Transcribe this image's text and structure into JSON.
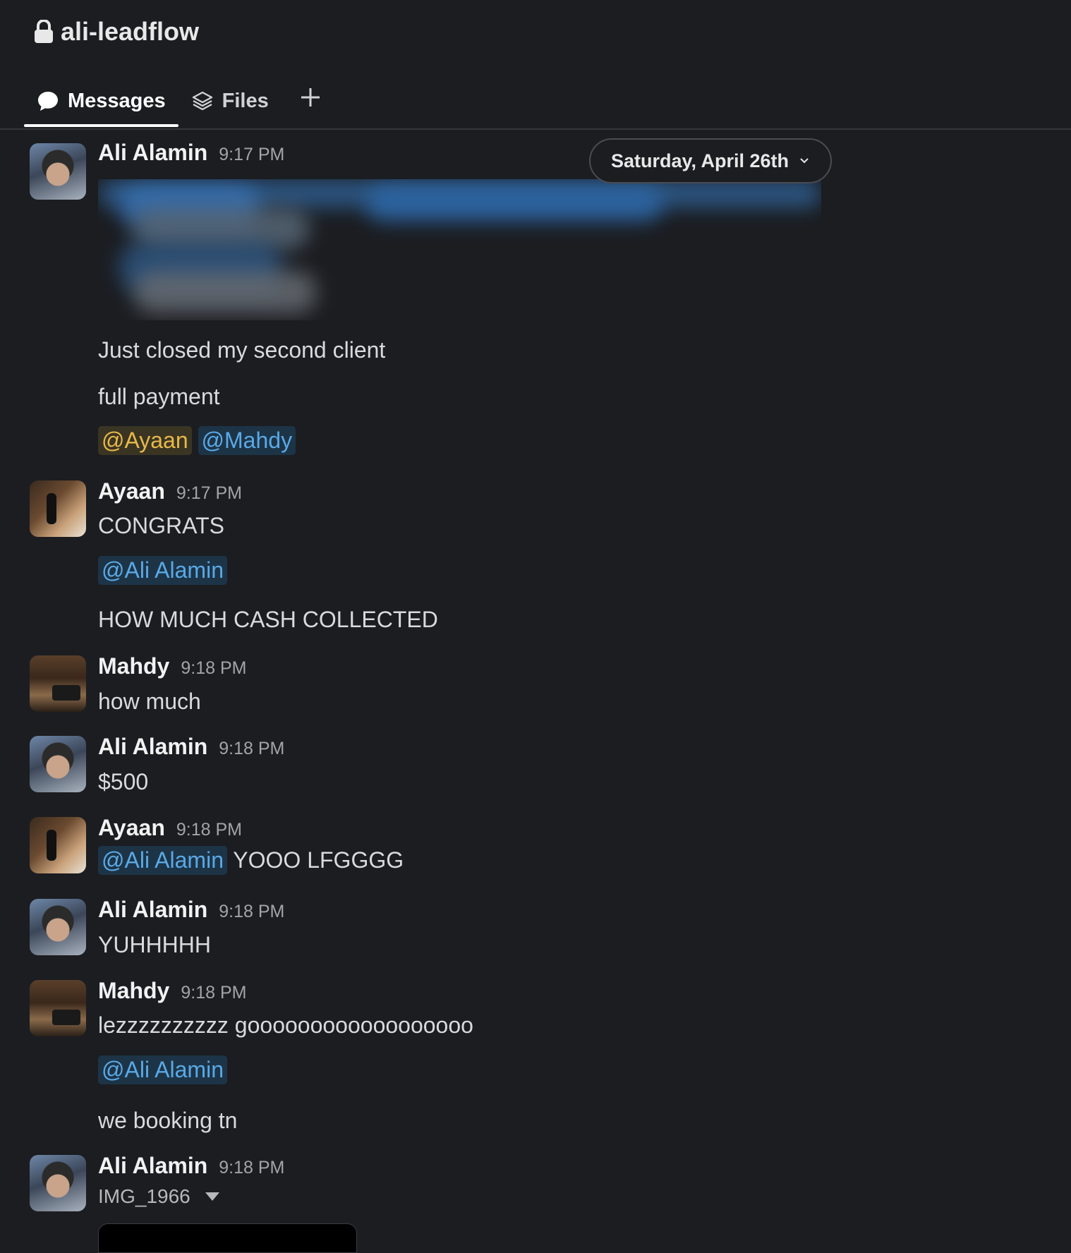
{
  "channel": {
    "name": "ali-leadflow"
  },
  "tabs": [
    {
      "label": "Messages",
      "active": true
    },
    {
      "label": "Files",
      "active": false
    }
  ],
  "date_divider": "Saturday, April 26th",
  "messages": [
    {
      "author": "Ali Alamin",
      "time": "9:17 PM",
      "lines": [
        "Just closed my second client",
        "full payment"
      ],
      "mentions": [
        "@Ayaan",
        "@Mahdy"
      ]
    },
    {
      "author": "Ayaan",
      "time": "9:17 PM",
      "lines": [
        "CONGRATS",
        "HOW MUCH CASH COLLECTED"
      ],
      "mention": "@Ali Alamin"
    },
    {
      "author": "Mahdy",
      "time": "9:18 PM",
      "lines": [
        "how much"
      ]
    },
    {
      "author": "Ali Alamin",
      "time": "9:18 PM",
      "lines": [
        "$500"
      ]
    },
    {
      "author": "Ayaan",
      "time": "9:18 PM",
      "mention": "@Ali Alamin",
      "lines": [
        " YOOO LFGGGG"
      ]
    },
    {
      "author": "Ali Alamin",
      "time": "9:18 PM",
      "lines": [
        "YUHHHHH"
      ]
    },
    {
      "author": "Mahdy",
      "time": "9:18 PM",
      "lines": [
        "lezzzzzzzzzz goooooooooooooooooo",
        "we booking tn"
      ],
      "mention": "@Ali Alamin"
    },
    {
      "author": "Ali Alamin",
      "time": "9:18 PM",
      "file": "IMG_1966"
    }
  ],
  "colors": {
    "background": "#1b1d21",
    "mention_bg": "#1d3447",
    "mention_fg": "#5aa9e6",
    "self_mention_fg": "#e8b84a"
  }
}
